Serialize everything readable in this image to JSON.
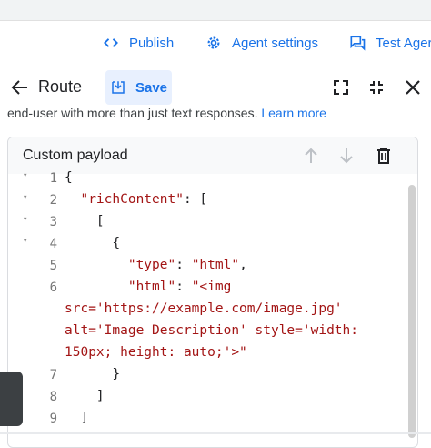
{
  "toolbar": {
    "publish": "Publish",
    "agent_settings": "Agent settings",
    "test_agent": "Test Ager"
  },
  "route": {
    "title": "Route",
    "save": "Save"
  },
  "help": {
    "text": "end-user with more than just text responses.",
    "link": "Learn more"
  },
  "payload": {
    "title": "Custom payload",
    "lines": [
      {
        "num": "1",
        "fold": true
      },
      {
        "num": "2",
        "fold": true
      },
      {
        "num": "3",
        "fold": true
      },
      {
        "num": "4",
        "fold": true
      },
      {
        "num": "5",
        "fold": false
      },
      {
        "num": "6",
        "fold": false
      },
      {
        "num": "7",
        "fold": false
      },
      {
        "num": "8",
        "fold": false
      },
      {
        "num": "9",
        "fold": false
      }
    ],
    "code": {
      "l1": "{",
      "l2_key": "\"richContent\"",
      "l2_rest": ": [",
      "l3": "[",
      "l4": "{",
      "l5_key": "\"type\"",
      "l5_sep": ": ",
      "l5_val": "\"html\"",
      "l5_end": ",",
      "l6_key": "\"html\"",
      "l6_sep": ": ",
      "l6_val": "\"<img",
      "w1": "src='https://example.com/image.jpg'",
      "w2": "alt='Image Description' style='width:",
      "w3": "150px; height: auto;'>\"",
      "l7": "}",
      "l8": "]",
      "l9": "]"
    }
  }
}
